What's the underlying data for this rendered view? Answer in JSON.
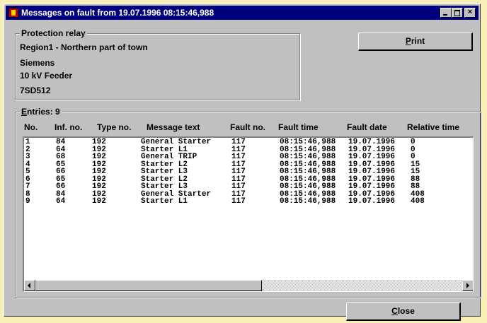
{
  "window": {
    "title": "Messages on fault from 19.07.1996 08:15:46,988"
  },
  "relay": {
    "label": "Protection relay",
    "lines": [
      "Region1 -  Northern part of town",
      "Siemens",
      "10 kV Feeder",
      "7SD512"
    ]
  },
  "print_button": {
    "accel": "P",
    "rest": "rint"
  },
  "entries": {
    "accel": "E",
    "rest": "ntries: 9",
    "columns": [
      "No.",
      "Inf. no.",
      "Type no.",
      "Message text",
      "Fault no.",
      "Fault time",
      "Fault date",
      "Relative time"
    ],
    "rows": [
      [
        "1",
        "84",
        "192",
        "General Starter",
        "117",
        "08:15:46,988",
        "19.07.1996",
        "0"
      ],
      [
        "2",
        "64",
        "192",
        "Starter L1",
        "117",
        "08:15:46,988",
        "19.07.1996",
        "0"
      ],
      [
        "3",
        "68",
        "192",
        "General TRIP",
        "117",
        "08:15:46,988",
        "19.07.1996",
        "0"
      ],
      [
        "4",
        "65",
        "192",
        "Starter L2",
        "117",
        "08:15:46,988",
        "19.07.1996",
        "15"
      ],
      [
        "5",
        "66",
        "192",
        "Starter L3",
        "117",
        "08:15:46,988",
        "19.07.1996",
        "15"
      ],
      [
        "6",
        "65",
        "192",
        "Starter L2",
        "117",
        "08:15:46,988",
        "19.07.1996",
        "88"
      ],
      [
        "7",
        "66",
        "192",
        "Starter L3",
        "117",
        "08:15:46,988",
        "19.07.1996",
        "88"
      ],
      [
        "8",
        "84",
        "192",
        "General Starter",
        "117",
        "08:15:46,988",
        "19.07.1996",
        "408"
      ],
      [
        "9",
        "64",
        "192",
        "Starter L1",
        "117",
        "08:15:46,988",
        "19.07.1996",
        "408"
      ]
    ]
  },
  "close_button": {
    "accel": "C",
    "rest": "lose"
  }
}
